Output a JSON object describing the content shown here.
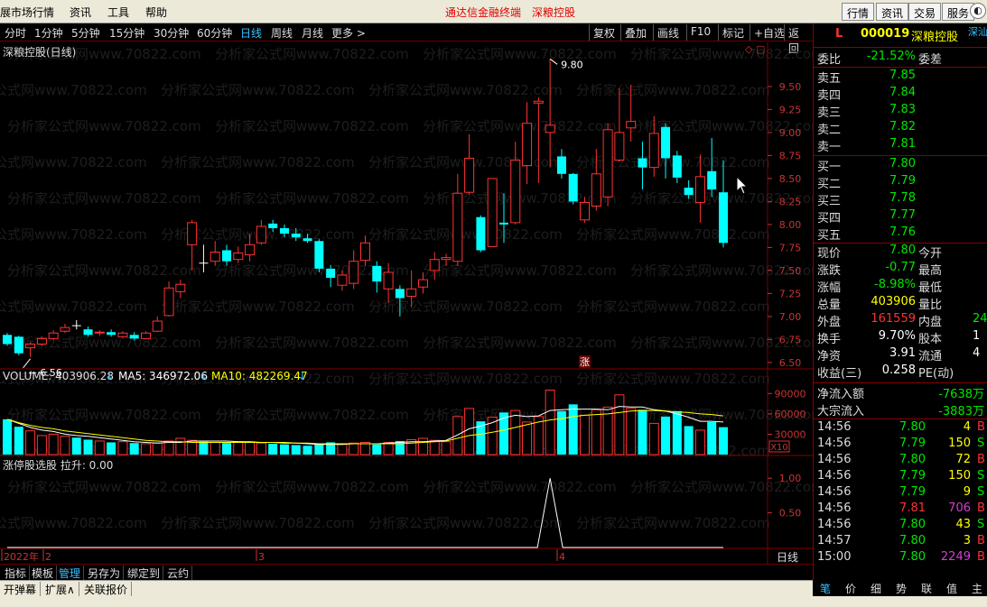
{
  "menu": {
    "items": [
      "展市场行情",
      "资讯",
      "工具",
      "帮助"
    ],
    "title": [
      "通达信金融终端",
      "深粮控股"
    ],
    "right_buttons": [
      "行情",
      "资讯",
      "交易",
      "服务"
    ]
  },
  "toolbar": {
    "periods": [
      "分时",
      "1分钟",
      "5分钟",
      "15分钟",
      "30分钟",
      "60分钟",
      "日线",
      "周线",
      "月线",
      "更多 >"
    ],
    "active_period": "日线",
    "buttons": [
      "复权",
      "叠加",
      "画线",
      "F10",
      "标记",
      "+自选",
      "返回"
    ]
  },
  "chart_title": "深粮控股(日线)",
  "chart_data": {
    "type": "candlestick",
    "price_axis": {
      "ticks": [
        "9.50",
        "9.25",
        "9.00",
        "8.75",
        "8.50",
        "8.25",
        "8.00",
        "7.75",
        "7.50",
        "7.25",
        "7.00",
        "6.75",
        "6.50"
      ],
      "min": 6.45,
      "max": 9.95
    },
    "high_label": "9.80",
    "low_label": "6.56",
    "candles": [
      [
        6.8,
        6.7,
        6.82,
        6.68
      ],
      [
        6.78,
        6.6,
        6.79,
        6.58
      ],
      [
        6.66,
        6.7,
        6.72,
        6.56
      ],
      [
        6.7,
        6.76,
        6.78,
        6.68
      ],
      [
        6.76,
        6.82,
        6.85,
        6.74
      ],
      [
        6.84,
        6.88,
        6.92,
        6.82
      ],
      [
        6.9,
        6.9,
        6.96,
        6.86
      ],
      [
        6.86,
        6.8,
        6.89,
        6.78
      ],
      [
        6.82,
        6.83,
        6.85,
        6.79
      ],
      [
        6.83,
        6.8,
        6.86,
        6.78
      ],
      [
        6.78,
        6.82,
        6.84,
        6.76
      ],
      [
        6.8,
        6.76,
        6.83,
        6.74
      ],
      [
        6.76,
        6.82,
        6.84,
        6.75
      ],
      [
        6.84,
        6.95,
        7.0,
        6.83
      ],
      [
        7.01,
        7.31,
        7.38,
        7.0
      ],
      [
        7.27,
        7.35,
        7.4,
        7.2
      ],
      [
        7.78,
        8.02,
        8.05,
        7.5
      ],
      [
        7.58,
        7.58,
        7.78,
        7.48
      ],
      [
        7.6,
        7.7,
        7.82,
        7.55
      ],
      [
        7.72,
        7.6,
        7.78,
        7.55
      ],
      [
        7.62,
        7.69,
        7.76,
        7.58
      ],
      [
        7.67,
        7.78,
        7.9,
        7.6
      ],
      [
        7.8,
        7.98,
        8.05,
        7.78
      ],
      [
        8.01,
        7.96,
        8.05,
        7.92
      ],
      [
        7.96,
        7.9,
        8.0,
        7.86
      ],
      [
        7.9,
        7.86,
        7.96,
        7.82
      ],
      [
        7.85,
        7.82,
        7.9,
        7.8
      ],
      [
        7.82,
        7.52,
        7.84,
        7.48
      ],
      [
        7.52,
        7.42,
        7.56,
        7.32
      ],
      [
        7.34,
        7.45,
        7.5,
        7.28
      ],
      [
        7.36,
        7.6,
        7.72,
        7.3
      ],
      [
        7.61,
        7.8,
        7.88,
        7.55
      ],
      [
        7.55,
        7.38,
        7.6,
        7.26
      ],
      [
        7.3,
        7.48,
        7.58,
        7.15
      ],
      [
        7.3,
        7.2,
        7.34,
        7.0
      ],
      [
        7.22,
        7.3,
        7.5,
        7.1
      ],
      [
        7.32,
        7.4,
        7.48,
        7.25
      ],
      [
        7.5,
        7.62,
        7.7,
        7.4
      ],
      [
        7.62,
        7.64,
        7.68,
        7.55
      ],
      [
        7.6,
        8.34,
        8.55,
        7.55
      ],
      [
        8.35,
        8.72,
        8.98,
        8.32
      ],
      [
        8.08,
        7.72,
        8.1,
        7.7
      ],
      [
        7.76,
        8.5,
        8.5,
        7.76
      ],
      [
        8.02,
        8.0,
        8.34,
        7.8
      ],
      [
        8.02,
        8.7,
        8.9,
        8.0
      ],
      [
        8.64,
        9.1,
        9.33,
        8.44
      ],
      [
        9.32,
        9.34,
        9.38,
        8.45
      ],
      [
        9.0,
        9.08,
        9.8,
        8.62
      ],
      [
        8.74,
        8.55,
        8.82,
        8.5
      ],
      [
        8.55,
        8.25,
        8.56,
        8.22
      ],
      [
        8.05,
        8.24,
        8.3,
        8.02
      ],
      [
        8.2,
        8.55,
        8.82,
        8.15
      ],
      [
        8.3,
        9.03,
        9.1,
        8.2
      ],
      [
        8.7,
        9.0,
        9.48,
        8.68
      ],
      [
        9.05,
        9.12,
        9.52,
        8.9
      ],
      [
        8.72,
        8.62,
        8.9,
        8.38
      ],
      [
        8.62,
        8.99,
        9.18,
        8.52
      ],
      [
        9.06,
        8.72,
        9.1,
        8.5
      ],
      [
        8.75,
        8.51,
        8.8,
        8.45
      ],
      [
        8.4,
        8.32,
        8.48,
        8.28
      ],
      [
        8.24,
        8.52,
        8.76,
        8.02
      ],
      [
        8.58,
        8.38,
        8.94,
        8.3
      ],
      [
        8.35,
        7.8,
        8.7,
        7.75
      ]
    ],
    "volume": {
      "label": "VOLUME: 403906.28",
      "ma5_label": "MA5: 346972.06",
      "ma10_label": "MA10: 482269.47",
      "ticks": [
        "90000",
        "60000",
        "30000"
      ],
      "unit": "X10",
      "values": [
        52000,
        41000,
        35000,
        28000,
        30000,
        27000,
        25000,
        22000,
        20000,
        18000,
        19000,
        17000,
        16000,
        17000,
        20000,
        24000,
        21000,
        19000,
        18000,
        17000,
        19000,
        18000,
        17000,
        16000,
        15000,
        14000,
        13000,
        16000,
        18000,
        15000,
        17000,
        18000,
        15000,
        18000,
        20000,
        22000,
        24000,
        21000,
        19000,
        56000,
        68000,
        49000,
        55000,
        62000,
        65000,
        48000,
        56000,
        95000,
        64000,
        74000,
        58000,
        66000,
        70000,
        88000,
        68000,
        66000,
        46000,
        56000,
        64000,
        42000,
        36000,
        48000,
        40390
      ],
      "ma5": [
        52000,
        46000,
        40000,
        36000,
        34000,
        30000,
        28000,
        27000,
        25000,
        23000,
        21000,
        19000,
        18000,
        17000,
        18000,
        18000,
        20000,
        20000,
        20000,
        20000,
        19000,
        19000,
        18000,
        18000,
        17000,
        17000,
        16000,
        15000,
        15000,
        15000,
        16000,
        16000,
        16000,
        17000,
        18000,
        19000,
        19000,
        20000,
        21000,
        29000,
        38000,
        42000,
        47000,
        54000,
        58000,
        56000,
        57000,
        65000,
        66000,
        67000,
        67000,
        67000,
        66000,
        71000,
        70000,
        70000,
        66000,
        64000,
        60000,
        55000,
        49000,
        49000,
        48000
      ],
      "ma10": [
        52000,
        47000,
        43000,
        40000,
        38000,
        35000,
        33000,
        31000,
        29000,
        27000,
        25000,
        23000,
        21000,
        20000,
        19000,
        19000,
        18000,
        18000,
        18000,
        18000,
        18000,
        18000,
        18000,
        18000,
        18000,
        17000,
        17000,
        16000,
        16000,
        16000,
        16000,
        16000,
        16000,
        16000,
        16000,
        17000,
        18000,
        19000,
        20000,
        24000,
        28000,
        30000,
        33000,
        36000,
        40000,
        44000,
        48000,
        51000,
        53000,
        56000,
        58000,
        59000,
        60000,
        62000,
        64000,
        65000,
        65000,
        64000,
        63000,
        62000,
        60000,
        59000,
        57000
      ]
    },
    "zt_label": "涨",
    "indicator": {
      "label": "涨停股选股  拉升: 0.00",
      "ticks": [
        "1.00",
        "0.50"
      ],
      "pulse_index": 47
    },
    "date_labels": [
      "2022年",
      "2",
      "3",
      "4"
    ]
  },
  "panel": {
    "code_mark": "L",
    "code": "000019",
    "name": "深粮控股",
    "extra": "深汕",
    "weibi_label": "委比",
    "weibi": "-21.52%",
    "weicha_label": "委差",
    "sells": [
      [
        "卖五",
        "7.85"
      ],
      [
        "卖四",
        "7.84"
      ],
      [
        "卖三",
        "7.83"
      ],
      [
        "卖二",
        "7.82"
      ],
      [
        "卖一",
        "7.81"
      ]
    ],
    "buys": [
      [
        "买一",
        "7.80"
      ],
      [
        "买二",
        "7.79"
      ],
      [
        "买三",
        "7.78"
      ],
      [
        "买四",
        "7.77"
      ],
      [
        "买五",
        "7.76"
      ]
    ],
    "stats": [
      [
        "现价",
        "7.80",
        "今开",
        ""
      ],
      [
        "涨跌",
        "-0.77",
        "最高",
        ""
      ],
      [
        "涨幅",
        "-8.98%",
        "最低",
        ""
      ],
      [
        "总量",
        "403906",
        "量比",
        ""
      ],
      [
        "外盘",
        "161559",
        "内盘",
        "24"
      ],
      [
        "换手",
        "9.70%",
        "股本",
        "1"
      ],
      [
        "净资",
        "3.91",
        "流通",
        "4"
      ],
      [
        "收益(三)",
        "0.258",
        "PE(动)",
        ""
      ]
    ],
    "flows": [
      [
        "净流入额",
        "-7638万"
      ],
      [
        "大宗流入",
        "-3883万"
      ]
    ],
    "ticks": [
      [
        "14:56",
        "7.80",
        "4",
        "B"
      ],
      [
        "14:56",
        "7.79",
        "150",
        "S"
      ],
      [
        "14:56",
        "7.80",
        "72",
        "B"
      ],
      [
        "14:56",
        "7.79",
        "150",
        "S"
      ],
      [
        "14:56",
        "7.79",
        "9",
        "S"
      ],
      [
        "14:56",
        "7.81",
        "706",
        "B"
      ],
      [
        "14:56",
        "7.80",
        "43",
        "S"
      ],
      [
        "14:57",
        "7.80",
        "3",
        "B"
      ],
      [
        "15:00",
        "7.80",
        "2249",
        "B"
      ]
    ]
  },
  "bottom_tabs": [
    "指标",
    "模板",
    "管理",
    "另存为",
    "绑定到",
    "云约"
  ],
  "bottom_active": "管理",
  "bottom_bar": [
    "开弹幕",
    "扩展∧",
    "关联报价"
  ],
  "period_label": "日线",
  "zoom_buttons": [
    "+",
    "-",
    "0"
  ],
  "right_tabs": [
    "笔",
    "价",
    "细",
    "势",
    "联",
    "值",
    "主"
  ],
  "watermark": "分析家公式网www.70822.com",
  "colors": {
    "up": "#ff3232",
    "down": "#00ffff",
    "ma5": "#ffffff",
    "ma10": "#ffff00",
    "green": "#00e600",
    "frame": "#800000"
  }
}
